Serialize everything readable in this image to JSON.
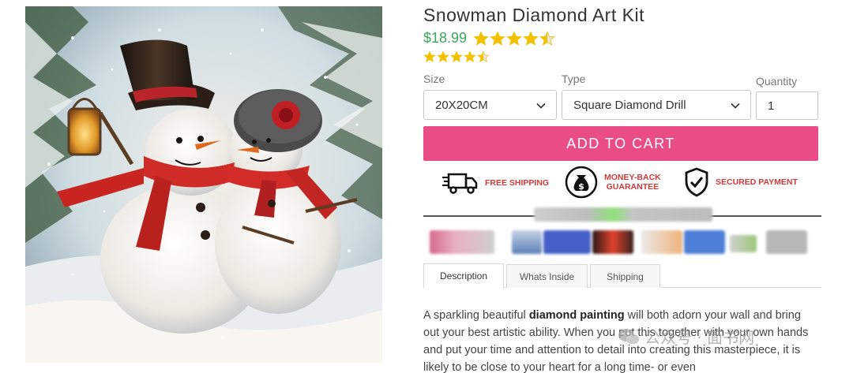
{
  "product": {
    "title": "Snowman Diamond Art Kit",
    "price": "$18.99",
    "rating_stars": 4.5,
    "review_stars": 4.5,
    "image_alt": "Snowman couple painting"
  },
  "options": {
    "size_label": "Size",
    "size_value": "20X20CM",
    "type_label": "Type",
    "type_value": "Square Diamond Drill",
    "quantity_label": "Quantity",
    "quantity_value": "1"
  },
  "cart": {
    "add_label": "ADD TO CART"
  },
  "badges": {
    "shipping": "FREE SHIPPING",
    "money_back_1": "MONEY-BACK",
    "money_back_2": "GUARANTEE",
    "secured": "SECURED PAYMENT"
  },
  "tabs": [
    {
      "label": "Description"
    },
    {
      "label": "Whats Inside"
    },
    {
      "label": "Shipping"
    }
  ],
  "description": {
    "p1_a": "A sparkling beautiful ",
    "p1_bold": "diamond painting",
    "p1_b": " will both adorn your wall and bring out your best artistic ability. When you put this together with your own hands and put your time and attention to detail into creating this masterpiece, it is likely to be close to your heart for a long time- or even"
  },
  "watermark": {
    "text": "公众号 · 面书网"
  },
  "colors": {
    "accent": "#ea4c88",
    "price": "#3aa65b",
    "star": "#f2c200",
    "badge_text": "#d23a3a"
  },
  "icons": {
    "truck": "truck-icon",
    "money": "money-bag-icon",
    "shield": "shield-check-icon",
    "chevron": "chevron-down-icon",
    "wechat": "wechat-icon"
  }
}
